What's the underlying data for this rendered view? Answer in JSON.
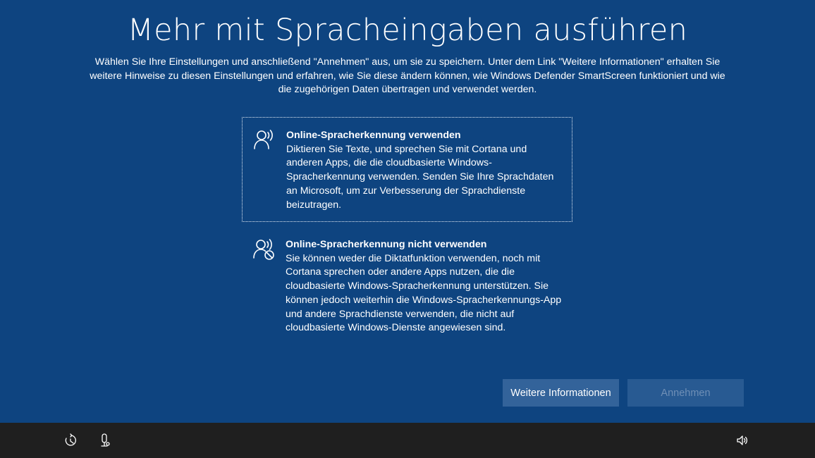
{
  "page": {
    "title": "Mehr mit Spracheingaben ausführen",
    "intro": "Wählen Sie Ihre Einstellungen und anschließend \"Annehmen\" aus, um sie zu speichern. Unter dem Link \"Weitere Informationen\" erhalten Sie weitere Hinweise zu diesen Einstellungen und erfahren, wie Sie diese ändern können, wie Windows Defender SmartScreen funktioniert und wie die zugehörigen Daten übertragen und verwendet werden."
  },
  "options": [
    {
      "title": "Online-Spracherkennung verwenden",
      "description": "Diktieren Sie Texte, und sprechen Sie mit Cortana und anderen Apps, die die cloudbasierte Windows-Spracherkennung verwenden. Senden Sie Ihre Sprachdaten an Microsoft, um zur Verbesserung der Sprachdienste beizutragen.",
      "icon": "speech-recognition-icon",
      "selected": true
    },
    {
      "title": "Online-Spracherkennung nicht verwenden",
      "description": "Sie können weder die Diktatfunktion verwenden, noch mit Cortana sprechen oder andere Apps nutzen, die die cloudbasierte Windows-Spracherkennung unterstützen. Sie können jedoch weiterhin die Windows-Spracherkennungs-App und andere Sprachdienste verwenden, die nicht auf cloudbasierte Windows-Dienste angewiesen sind.",
      "icon": "speech-recognition-disabled-icon",
      "selected": false
    }
  ],
  "buttons": {
    "more_info": "Weitere Informationen",
    "accept": "Annehmen"
  },
  "taskbar": {
    "icons": [
      "ease-of-access-icon",
      "microphone-icon",
      "volume-icon"
    ]
  },
  "colors": {
    "background": "#0e4480",
    "taskbar": "#1f1f1f",
    "button_info": "#33639a",
    "button_accept_disabled": "#285a92",
    "text": "#ffffff"
  }
}
